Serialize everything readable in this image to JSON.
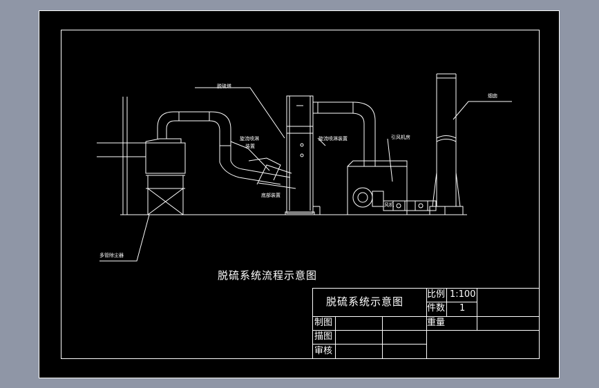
{
  "labels": {
    "desulfurization_tower": "脱硫塔",
    "swirl_spray_left_line1": "旋流喷淋",
    "swirl_spray_left_line2": "装置",
    "swirl_spray_right": "旋流喷淋装置",
    "fan_room": "引风机房",
    "chimney": "烟囱",
    "multitube_dust_collector": "多管除尘器",
    "bottom_device": "底部装置",
    "fan_tag": "风机"
  },
  "diagram_title": "脱硫系统流程示意图",
  "title_block": {
    "drawing_name": "脱硫系统示意图",
    "scale_label": "比例",
    "scale_value": "1:100",
    "count_label": "件数",
    "count_value": "1",
    "weight_label": "重量",
    "drawn_label": "制图",
    "traced_label": "描图",
    "checked_label": "审核"
  },
  "colors": {
    "background": "#000000",
    "lines": "#ffffff",
    "frame": "#8f96a6"
  }
}
